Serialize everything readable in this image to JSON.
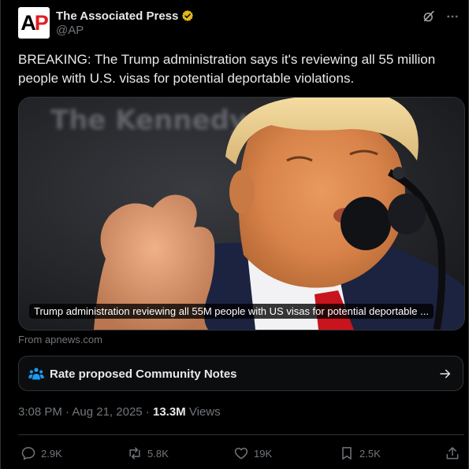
{
  "account": {
    "display_name": "The Associated Press",
    "handle": "@AP",
    "logo_text_a": "A",
    "logo_text_p": "P"
  },
  "tweet": {
    "text": "BREAKING: The Trump administration says it's reviewing all 55 million people with U.S. visas for potential deportable violations.",
    "media_caption": "Trump administration reviewing all 55M people with US visas for potential deportable ...",
    "background_sign_text": "The Kennedy Center",
    "source": "From apnews.com"
  },
  "community_notes": {
    "label": "Rate proposed Community Notes"
  },
  "meta": {
    "time": "3:08 PM",
    "separator": " · ",
    "date": "Aug 21, 2025",
    "views_count": "13.3M",
    "views_label": " Views"
  },
  "actions": {
    "replies": "2.9K",
    "reposts": "5.8K",
    "likes": "19K",
    "bookmarks": "2.5K"
  },
  "icons": {
    "verified": "verified-badge-icon",
    "grok": "grok-icon",
    "more": "more-icon",
    "notes": "community-notes-icon",
    "arrow": "arrow-right-icon",
    "reply": "reply-icon",
    "repost": "repost-icon",
    "like": "heart-icon",
    "bookmark": "bookmark-icon",
    "share": "share-icon"
  },
  "colors": {
    "background": "#000000",
    "text": "#e7e9ea",
    "muted": "#71767b",
    "border": "#2f3336",
    "verified_gold": "#e2b719",
    "notes_blue": "#1d9bf0",
    "ap_red": "#e31b23"
  }
}
